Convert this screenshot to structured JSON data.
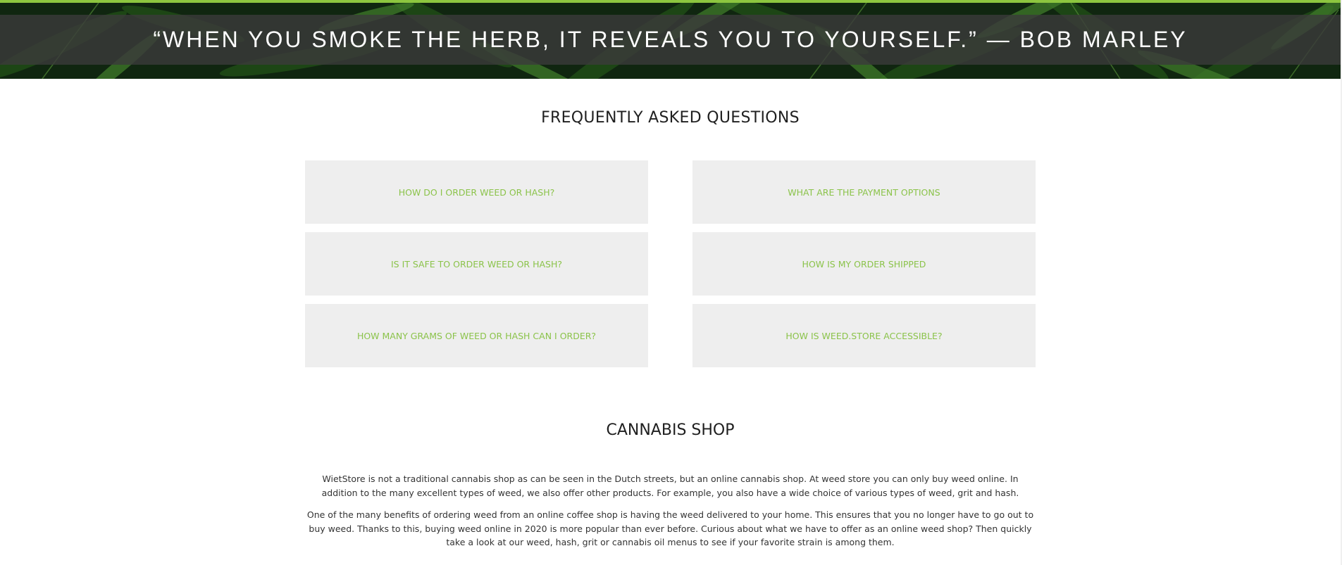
{
  "hero": {
    "quote": "“WHEN YOU SMOKE THE HERB, IT REVEALS YOU TO YOURSELF.” — BOB MARLEY",
    "accent_color": "#8dc63f"
  },
  "faq": {
    "title": "FREQUENTLY ASKED QUESTIONS",
    "link_color": "#8bc34a",
    "items": [
      {
        "label": "HOW DO I ORDER WEED OR HASH?"
      },
      {
        "label": "WHAT ARE THE PAYMENT OPTIONS"
      },
      {
        "label": "IS IT SAFE TO ORDER WEED OR HASH?"
      },
      {
        "label": "HOW IS MY ORDER SHIPPED"
      },
      {
        "label": "HOW MANY GRAMS OF WEED OR HASH CAN I ORDER?"
      },
      {
        "label": "HOW IS WEED.STORE ACCESSIBLE?"
      }
    ]
  },
  "shop": {
    "title": "CANNABIS SHOP",
    "paragraphs": [
      "WietStore is not a traditional cannabis shop as can be seen in the Dutch streets, but an online cannabis shop. At weed store you can only buy weed online. In addition to the many excellent types of weed, we also offer other products. For example, you also have a wide choice of various types of weed, grit and hash.",
      "One of the many benefits of ordering weed from an online coffee shop is having the weed delivered to your home. This ensures that you no longer have to go out to buy weed. Thanks to this, buying weed online in 2020 is more popular than ever before. Curious about what we have to offer as an online weed shop? Then quickly take a look at our weed, hash, grit or cannabis oil menus to see if your favorite strain is among them."
    ]
  }
}
